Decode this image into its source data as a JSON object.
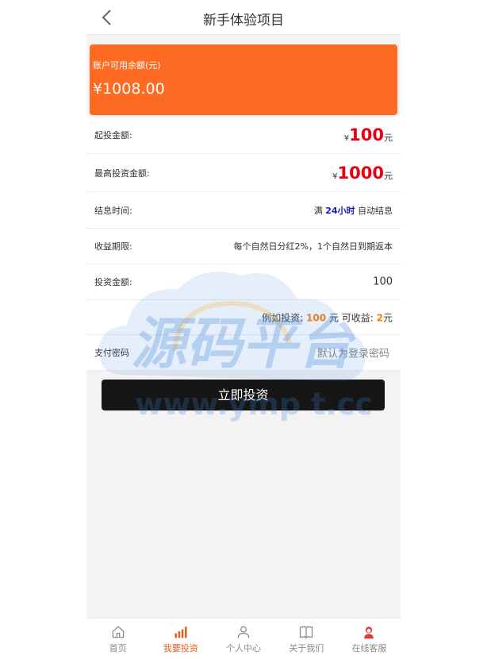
{
  "header": {
    "title": "新手体验项目",
    "back_icon": "chevron-left-icon"
  },
  "balance": {
    "label": "账户可用余额(元)",
    "value": "¥1008.00",
    "color": "#ff6a22"
  },
  "rows": {
    "min_invest": {
      "label": "起投金额:",
      "currency": "¥",
      "amount": "100",
      "unit": "元"
    },
    "max_invest": {
      "label": "最高投资金额:",
      "currency": "¥",
      "amount": "1000",
      "unit": "元"
    },
    "settle_time": {
      "label": "结息时间:",
      "prefix": "满",
      "hours": "24小时",
      "suffix": "自动结息"
    },
    "period": {
      "label": "收益期限:",
      "value": "每个自然日分红2%，1个自然日到期返本"
    },
    "invest_amount": {
      "label": "投资金额:",
      "value": "100"
    },
    "example": {
      "prefix": "例如投资:",
      "amount": "100",
      "mid": "元 可收益:",
      "profit": "2",
      "unit": "元"
    },
    "password": {
      "label": "支付密码",
      "placeholder": "默认为登录密码"
    }
  },
  "actions": {
    "invest_button": "立即投资"
  },
  "watermark": {
    "text": "源码平台",
    "url": "www.ymp t.cc"
  },
  "tabbar": {
    "items": [
      {
        "label": "首页",
        "icon": "home-icon"
      },
      {
        "label": "我要投资",
        "icon": "bar-chart-icon",
        "active": true
      },
      {
        "label": "个人中心",
        "icon": "user-icon"
      },
      {
        "label": "关于我们",
        "icon": "book-icon"
      },
      {
        "label": "在线客服",
        "icon": "support-agent-icon"
      }
    ]
  }
}
